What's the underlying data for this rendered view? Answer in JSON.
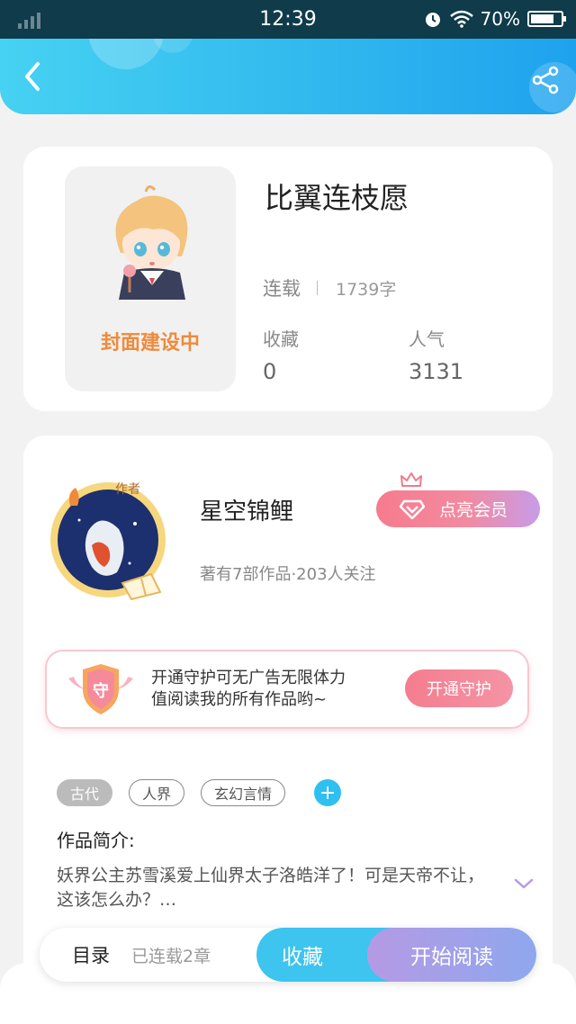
{
  "status_bar": {
    "time": "12:39",
    "battery": "70%"
  },
  "book": {
    "title": "比翼连枝愿",
    "cover_placeholder": "封面建设中",
    "status": "连载",
    "word_count": "1739字",
    "favorites_label": "收藏",
    "favorites_value": "0",
    "popularity_label": "人气",
    "popularity_value": "3131"
  },
  "author": {
    "name": "星空锦鲤",
    "badge": "作者",
    "meta": "著有7部作品·203人关注",
    "vip_button": "点亮会员"
  },
  "guard": {
    "icon_text": "守",
    "line1": "开通守护可无广告无限体力",
    "line2": "值阅读我的所有作品哟~",
    "button": "开通守护"
  },
  "tags": [
    {
      "label": "古代"
    },
    {
      "label": "人界"
    },
    {
      "label": "玄幻言情"
    }
  ],
  "intro": {
    "label": "作品简介:",
    "text": "妖界公主苏雪溪爱上仙界太子洛皓洋了！可是天帝不让，这该怎么办？…"
  },
  "bottom_bar": {
    "toc": "目录",
    "chapters": "已连载2章",
    "favorite": "收藏",
    "start_reading": "开始阅读"
  },
  "colors": {
    "header_accent": "#2fb6ee",
    "vip_pink": "#f77b8d",
    "guard_pink": "#f47d8e",
    "cover_text": "#f08a3b"
  }
}
